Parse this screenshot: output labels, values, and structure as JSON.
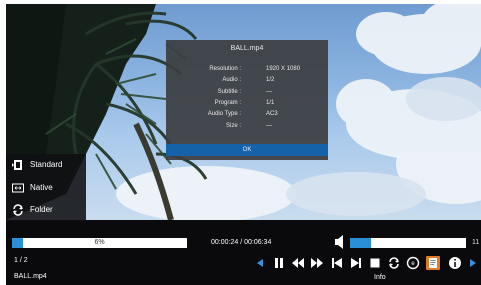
{
  "info_dialog": {
    "title": "BALL.mp4",
    "rows": [
      {
        "label": "Resolution :",
        "value": "1920 X 1080"
      },
      {
        "label": "Audio :",
        "value": "1/2"
      },
      {
        "label": "Subtitle :",
        "value": "—"
      },
      {
        "label": "Program :",
        "value": "1/1"
      },
      {
        "label": "Audio Type :",
        "value": "AC3"
      },
      {
        "label": "Size :",
        "value": "—"
      }
    ],
    "ok_label": "OK"
  },
  "aspect_menu": {
    "items": [
      {
        "label": "Standard",
        "icon": "standard-aspect-icon"
      },
      {
        "label": "Native",
        "icon": "native-aspect-icon"
      },
      {
        "label": "Folder",
        "icon": "folder-repeat-icon"
      }
    ]
  },
  "control_bar": {
    "progress_label": "6%",
    "progress_fraction": 0.06,
    "time": "00:00:24 / 00:06:34",
    "volume_fraction": 0.18,
    "volume_value": "11",
    "counter": "1 / 2",
    "filename": "BALL.mp4",
    "info_label": "Info",
    "buttons": [
      "prev-page-icon",
      "pause-icon",
      "rewind-icon",
      "fast-forward-icon",
      "skip-previous-icon",
      "skip-next-icon",
      "stop-icon",
      "repeat-icon",
      "audio-track-icon",
      "subtitle-icon",
      "info-icon",
      "next-page-icon"
    ]
  },
  "colors": {
    "accent": "#2a8fd6",
    "ok_button": "#1562a8",
    "dialog_bg": "#3c3e42",
    "bar_bg": "#0a0a0c"
  }
}
